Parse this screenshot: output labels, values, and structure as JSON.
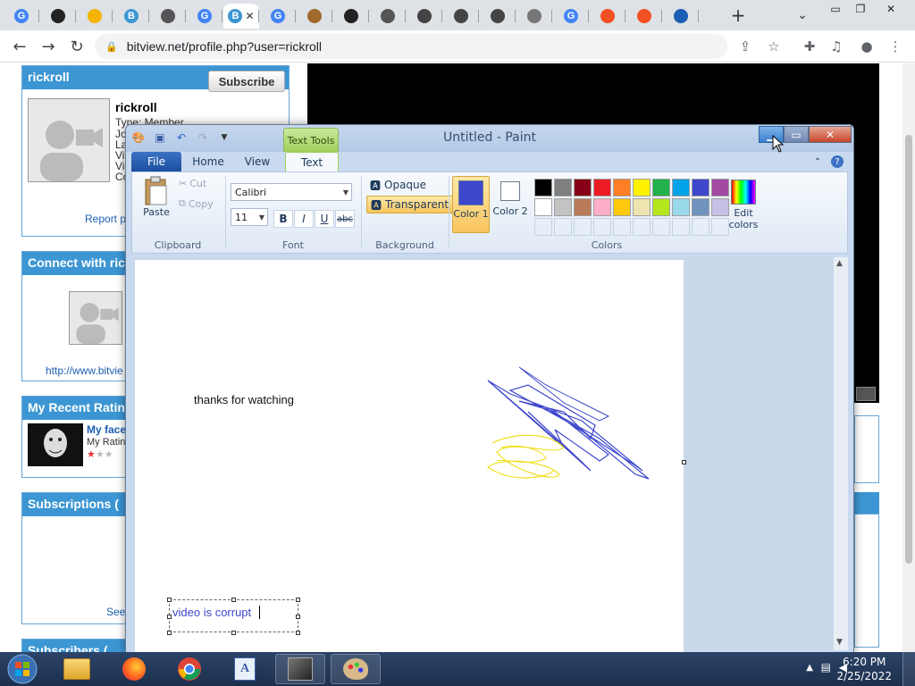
{
  "browser": {
    "url": "bitview.net/profile.php?user=rickroll",
    "tabs": [
      {
        "icon": "google-icon",
        "letter": "G",
        "color": "#4285f4"
      },
      {
        "icon": "github-icon",
        "letter": "",
        "color": "#222222"
      },
      {
        "icon": "doc-icon",
        "letter": "",
        "color": "#f4b400"
      },
      {
        "icon": "bitview-icon",
        "letter": "B",
        "color": "#3c96d3"
      },
      {
        "icon": "globe-icon",
        "letter": "",
        "color": "#555555"
      },
      {
        "icon": "google-icon",
        "letter": "G",
        "color": "#4285f4"
      },
      {
        "icon": "bitview-icon",
        "letter": "B",
        "color": "#3c96d3"
      },
      {
        "icon": "google-icon",
        "letter": "G",
        "color": "#4285f4"
      },
      {
        "icon": "bird-icon",
        "letter": "",
        "color": "#a06a2c"
      },
      {
        "icon": "archive-icon",
        "letter": "",
        "color": "#222222"
      },
      {
        "icon": "chrome-icon",
        "letter": "",
        "color": "#555555"
      },
      {
        "icon": "app-icon",
        "letter": "",
        "color": "#444444"
      },
      {
        "icon": "app-icon",
        "letter": "",
        "color": "#444444"
      },
      {
        "icon": "app-icon",
        "letter": "",
        "color": "#444444"
      },
      {
        "icon": "globe-icon",
        "letter": "",
        "color": "#777777"
      },
      {
        "icon": "google-icon",
        "letter": "G",
        "color": "#4285f4"
      },
      {
        "icon": "microsoft-icon",
        "letter": "",
        "color": "#f25022"
      },
      {
        "icon": "microsoft-icon",
        "letter": "",
        "color": "#f25022"
      },
      {
        "icon": "vimm-icon",
        "letter": "",
        "color": "#1a5fb4"
      }
    ]
  },
  "profile": {
    "username": "rickroll",
    "subscribe_label": "Subscribe",
    "name": "rickroll",
    "type_line": "Type: Member",
    "side_letters": [
      "Jo",
      "La",
      "Vi",
      "Vi",
      "Co"
    ],
    "report_label": "Report p",
    "connect_header": "Connect with ric",
    "connect_link": "http://www.bitvie",
    "ratings_header": "My Recent Ratin",
    "rating_title": "My face",
    "rating_sub": "My Ratin",
    "subscriptions_header": "Subscriptions (",
    "see_label": "See",
    "subscribers_header": "Subscribers ("
  },
  "paint": {
    "title": "Untitled - Paint",
    "text_tools_label": "Text Tools",
    "tabs": {
      "file": "File",
      "home": "Home",
      "view": "View",
      "text": "Text"
    },
    "clipboard": {
      "paste": "Paste",
      "cut": "Cut",
      "copy": "Copy",
      "label": "Clipboard"
    },
    "font": {
      "family": "Calibri",
      "size": "11",
      "bold": "B",
      "italic": "I",
      "underline": "U",
      "strike": "abc",
      "label": "Font"
    },
    "background": {
      "opaque": "Opaque",
      "transparent": "Transparent",
      "label": "Background"
    },
    "colors": {
      "color1_label": "Color 1",
      "color1_value": "#3f48cc",
      "color2_label": "Color 2",
      "color2_value": "#ffffff",
      "edit_label": "Edit colors",
      "label": "Colors",
      "palette_row1": [
        "#000000",
        "#7f7f7f",
        "#880015",
        "#ed1c24",
        "#ff7f27",
        "#fff200",
        "#22b14c",
        "#00a2e8",
        "#3f48cc",
        "#a349a4"
      ],
      "palette_row2": [
        "#ffffff",
        "#c3c3c3",
        "#b97a57",
        "#ffaec9",
        "#ffc90e",
        "#efe4b0",
        "#b5e61d",
        "#99d9ea",
        "#7092be",
        "#c8bfe7"
      ]
    },
    "canvas_text1": "thanks for watching",
    "canvas_text2": "video is corrupt"
  },
  "taskbar": {
    "time": "6:20 PM",
    "date": "2/25/2022"
  }
}
